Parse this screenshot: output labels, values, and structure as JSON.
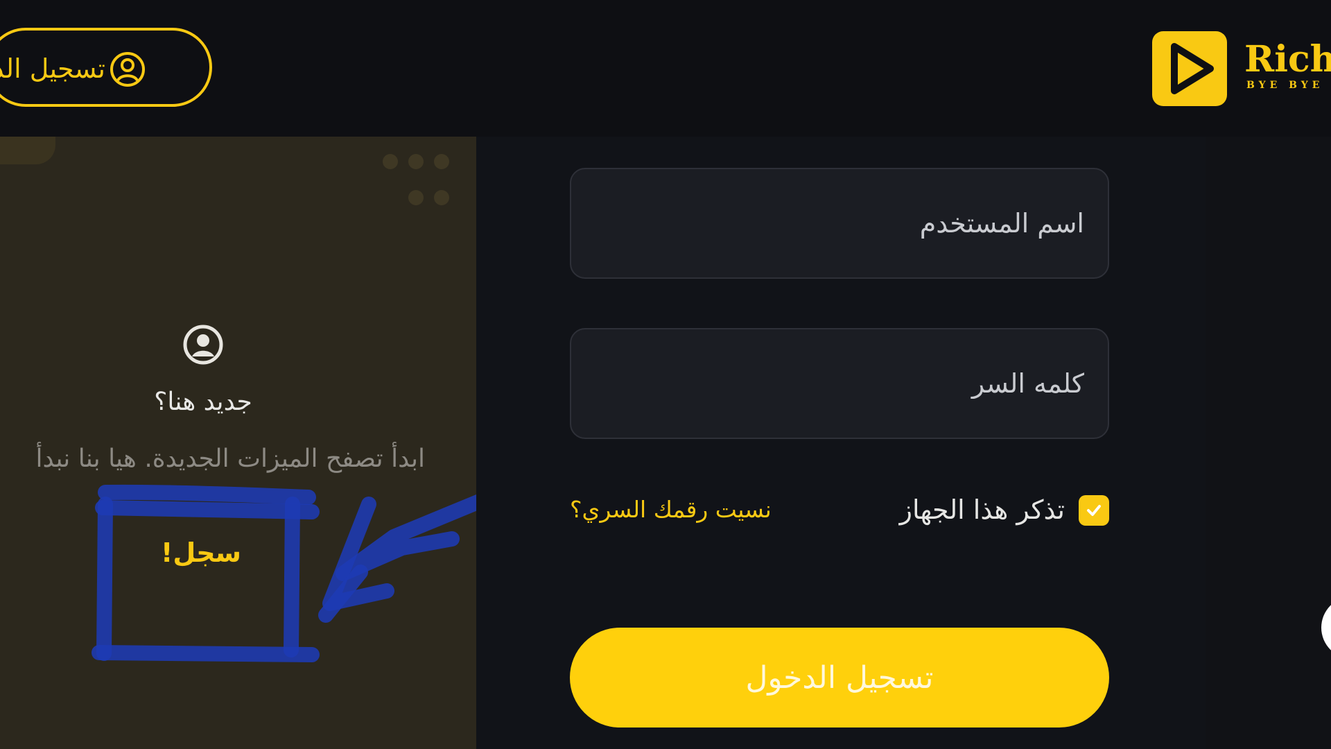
{
  "header": {
    "login_button_label": "تسجيل الدخول",
    "logo_text": "Rich",
    "logo_subtext": "BYE BYE"
  },
  "signup_panel": {
    "title": "جديد هنا؟",
    "subtitle": "ابدأ تصفح الميزات الجديدة. هيا بنا نبدأ",
    "signup_link": "سجل!"
  },
  "login_form": {
    "username_placeholder": "اسم المستخدم",
    "password_placeholder": "كلمه السر",
    "remember_label": "تذكر هذا الجهاز",
    "remember_checked": true,
    "forgot_link": "نسيت رقمك السري؟",
    "submit_label": "تسجيل الدخول"
  },
  "colors": {
    "accent": "#f9c913",
    "annotation": "#1e3ab4",
    "background": "#111216"
  },
  "icons": [
    "user-circle-icon",
    "play-logo-icon",
    "check-icon"
  ]
}
